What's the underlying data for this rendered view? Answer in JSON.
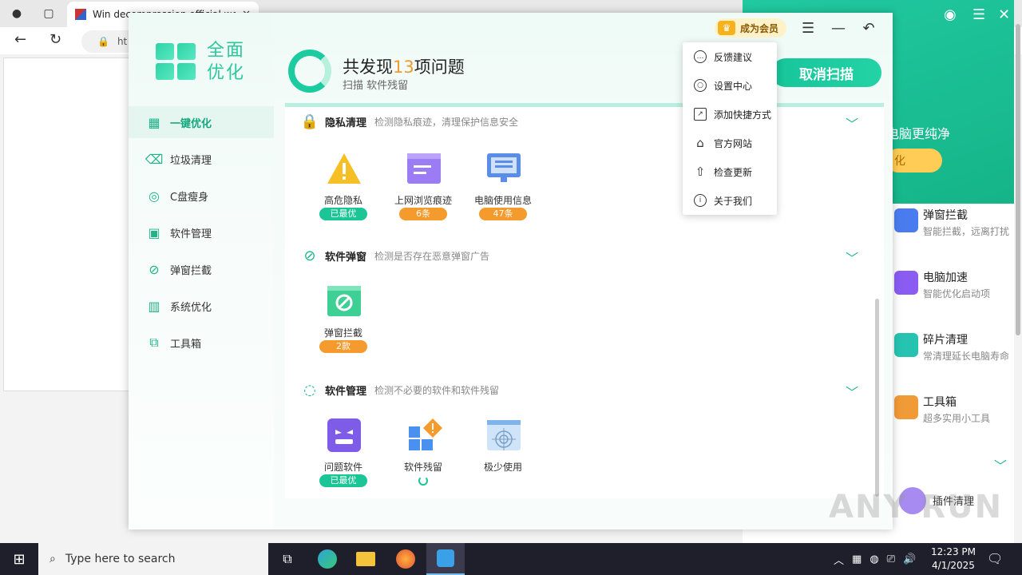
{
  "browser": {
    "tab_title": "Win decompression official web",
    "url_fragment": "ht"
  },
  "background_app": {
    "tagline": "电脑更纯净",
    "orange_button": "化",
    "features": [
      {
        "title": "弹窗拦截",
        "sub": "智能拦截，远离打扰",
        "color": "#4a7cf0"
      },
      {
        "title": "电脑加速",
        "sub": "智能优化启动项",
        "color": "#8a5cf2"
      },
      {
        "title": "碎片清理",
        "sub": "常清理延长电脑寿命",
        "color": "#26c4b0"
      },
      {
        "title": "工具箱",
        "sub": "超多实用小工具",
        "color": "#f19a38"
      }
    ],
    "plugin_label": "插件清理"
  },
  "app": {
    "logo_text": "全面优化",
    "sidebar": [
      {
        "label": "一键优化",
        "icon": "grid-icon",
        "glyph": "▦",
        "active": true
      },
      {
        "label": "垃圾清理",
        "icon": "trash-icon",
        "glyph": "🗑",
        "active": false
      },
      {
        "label": "C盘瘦身",
        "icon": "disk-icon",
        "glyph": "◎",
        "active": false
      },
      {
        "label": "软件管理",
        "icon": "apps-icon",
        "glyph": "▣",
        "active": false
      },
      {
        "label": "弹窗拦截",
        "icon": "block-icon",
        "glyph": "⊘",
        "active": false
      },
      {
        "label": "系统优化",
        "icon": "system-icon",
        "glyph": "▥",
        "active": false
      },
      {
        "label": "工具箱",
        "icon": "toolbox-icon",
        "glyph": "⧉",
        "active": false
      }
    ],
    "header": {
      "title_prefix": "共发现",
      "issue_count": "13",
      "title_suffix": "项问题",
      "subtitle": "扫描 软件残留",
      "cancel_label": "取消扫描",
      "vip_label": "成为会员"
    },
    "sections": [
      {
        "title": "隐私清理",
        "desc": "检测隐私痕迹，清理保护信息安全",
        "icon": "lock-icon",
        "items": [
          {
            "label": "高危隐私",
            "badge": "已最优",
            "badge_type": "green",
            "pic": "warning-icon"
          },
          {
            "label": "上网浏览痕迹",
            "badge": "6条",
            "badge_type": "orange",
            "pic": "browser-history-icon"
          },
          {
            "label": "电脑使用信息",
            "badge": "47条",
            "badge_type": "orange",
            "pic": "monitor-icon"
          }
        ]
      },
      {
        "title": "软件弹窗",
        "desc": "检测是否存在恶意弹窗广告",
        "icon": "popup-block-icon",
        "items": [
          {
            "label": "弹窗拦截",
            "badge": "2款",
            "badge_type": "orange",
            "pic": "popup-icon"
          }
        ]
      },
      {
        "title": "软件管理",
        "desc": "检测不必要的软件和软件残留",
        "icon": "loading-icon",
        "items": [
          {
            "label": "问题软件",
            "badge": "已最优",
            "badge_type": "green",
            "pic": "devil-icon"
          },
          {
            "label": "软件残留",
            "badge": "",
            "badge_type": "",
            "pic": "residue-icon"
          },
          {
            "label": "极少使用",
            "badge": "",
            "badge_type": "",
            "pic": "cobweb-icon"
          }
        ]
      }
    ],
    "menu": [
      {
        "label": "反馈建议",
        "icon": "feedback-icon",
        "glyph": "…"
      },
      {
        "label": "设置中心",
        "icon": "settings-icon",
        "glyph": "○"
      },
      {
        "label": "添加快捷方式",
        "icon": "shortcut-icon",
        "glyph": "↗"
      },
      {
        "label": "官方网站",
        "icon": "home-icon",
        "glyph": "⌂"
      },
      {
        "label": "检查更新",
        "icon": "update-icon",
        "glyph": "⇧"
      },
      {
        "label": "关于我们",
        "icon": "info-icon",
        "glyph": "i"
      }
    ]
  },
  "watermark": "ANY RUN",
  "taskbar": {
    "search_placeholder": "Type here to search",
    "time": "12:23 PM",
    "date": "4/1/2025"
  }
}
